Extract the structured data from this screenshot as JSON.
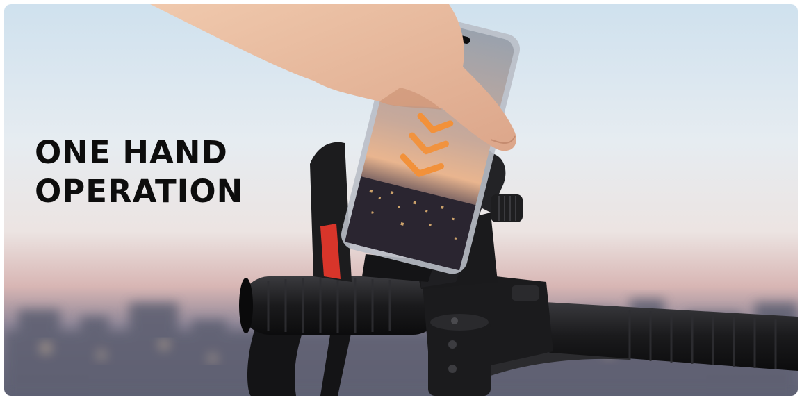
{
  "headline": {
    "line1": "ONE HAND",
    "line2": "OPERATION"
  },
  "colors": {
    "headline_text": "#0d0d0d",
    "sky_top": "#cfe1ee",
    "sky_haze": "#e9e3e0",
    "horizon_pink": "#d8b3b1",
    "city_dusk": "#6c6f80",
    "mount_black": "#1c1c1e",
    "mount_accent_red": "#d8352a",
    "arrow_orange": "#f2913a"
  }
}
